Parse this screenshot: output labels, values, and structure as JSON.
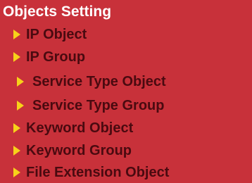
{
  "panel": {
    "title": "Objects Setting",
    "items": [
      {
        "label": "IP Object",
        "icon": "right-arrow-icon"
      },
      {
        "label": "IP Group",
        "icon": "right-arrow-icon"
      },
      {
        "label": "Service Type Object",
        "icon": "right-arrow-icon"
      },
      {
        "label": "Service Type Group",
        "icon": "right-arrow-icon"
      },
      {
        "label": "Keyword Object",
        "icon": "right-arrow-icon"
      },
      {
        "label": "Keyword Group",
        "icon": "right-arrow-icon"
      },
      {
        "label": "File Extension Object",
        "icon": "right-arrow-icon"
      }
    ]
  },
  "colors": {
    "panel_background": "#c8313a",
    "title_text": "#ffffff",
    "item_text": "#4a0a10",
    "arrow": "#f7d21a"
  }
}
